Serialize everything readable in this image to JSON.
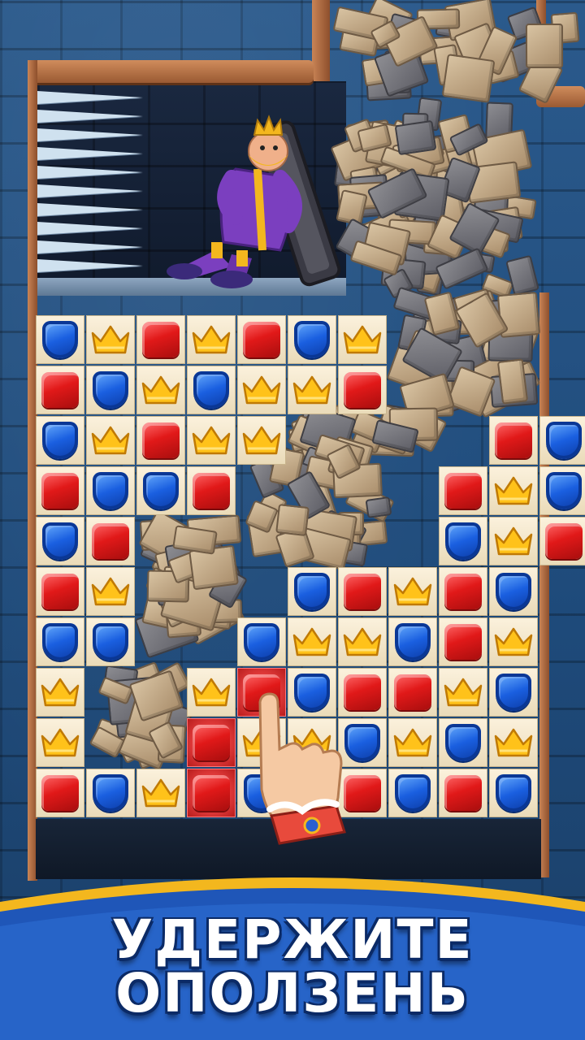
{
  "banner": {
    "line1": "УДЕРЖИТЕ",
    "line2": "ОПОЛЗЕНЬ"
  },
  "colors": {
    "red_gem": "#e11919",
    "blue_gem": "#1a5fe0",
    "crown_gem": "#ffc21a",
    "tile": "#f6ead0",
    "banner_blue": "#1f56b8",
    "banner_gold": "#f3b71e"
  },
  "board": {
    "rows": [
      [
        "blue",
        "crown",
        "red",
        "crown",
        "red",
        "blue",
        "crown",
        "",
        "",
        "",
        ""
      ],
      [
        "red",
        "blue",
        "crown",
        "blue",
        "crown",
        "crown",
        "red",
        "",
        "",
        "",
        ""
      ],
      [
        "blue",
        "crown",
        "red",
        "crown",
        "crown",
        "",
        "",
        "",
        "",
        "red",
        "blue"
      ],
      [
        "red",
        "blue",
        "blue",
        "red",
        "",
        "",
        "",
        "",
        "red",
        "crown",
        "blue"
      ],
      [
        "blue",
        "red",
        "",
        "",
        "",
        "",
        "",
        "",
        "blue",
        "crown",
        "red"
      ],
      [
        "red",
        "crown",
        "",
        "",
        "",
        "blue",
        "red",
        "crown",
        "red",
        "blue",
        ""
      ],
      [
        "blue",
        "blue",
        "",
        "",
        "blue",
        "crown",
        "crown",
        "blue",
        "red",
        "crown",
        ""
      ],
      [
        "crown",
        "",
        "",
        "crown",
        "red-glow",
        "blue",
        "red",
        "red",
        "crown",
        "blue",
        ""
      ],
      [
        "crown",
        "",
        "",
        "red-glow",
        "crown",
        "crown",
        "blue",
        "crown",
        "blue",
        "crown",
        ""
      ],
      [
        "red",
        "blue",
        "crown",
        "red-glow",
        "blue",
        "",
        "red",
        "blue",
        "red",
        "blue",
        ""
      ]
    ]
  },
  "icons": {
    "hand": "pointing-hand-icon",
    "king": "king-character",
    "spikes": "spike-trap-icon"
  }
}
